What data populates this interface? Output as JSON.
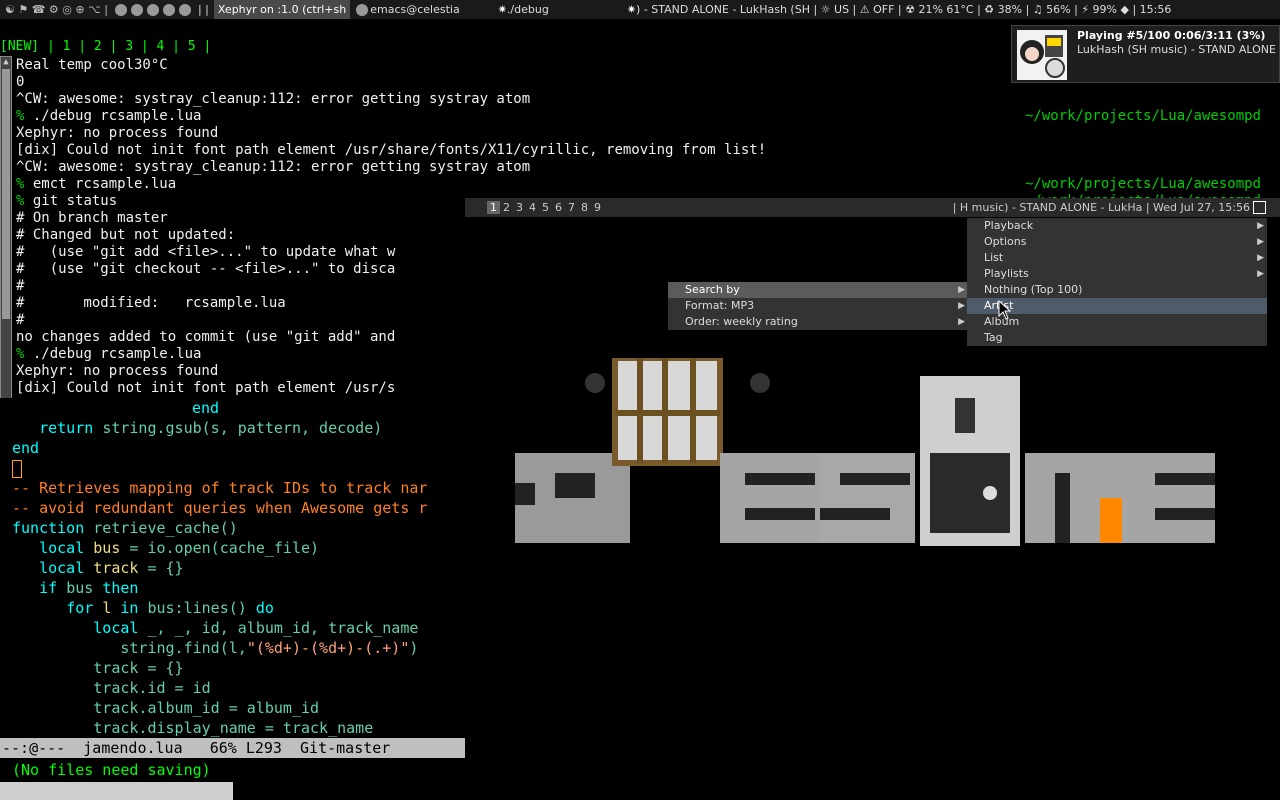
{
  "topbar": {
    "task1": "Xephyr on :1.0 (ctrl+sh",
    "task2": "emacs@celestia",
    "task3": "./debug",
    "status": ") - STAND ALONE - LukHash (SH   | ☼ US | ⚠ OFF | ☢ 21% 61°C | ♻ 38% | ♫ 56% | ⚡ 99% ◆ | 15:56"
  },
  "terminal": {
    "tags": "[NEW] | 1 | 2 | 3 | 4 | 5 |",
    "lines": [
      "Real temp cool30°C",
      "0",
      "^CW: awesome: systray_cleanup:112: error getting systray atom",
      "./debug rcsample.lua",
      "Xephyr: no process found",
      "[dix] Could not init font path element /usr/share/fonts/X11/cyrillic, removing from list!",
      "^CW: awesome: systray_cleanup:112: error getting systray atom",
      "emct rcsample.lua",
      "git status",
      "# On branch master",
      "# Changed but not updated:",
      "#   (use \"git add <file>...\" to update what w",
      "#   (use \"git checkout -- <file>...\" to disca",
      "#",
      "#       modified:   rcsample.lua",
      "#",
      "no changes added to commit (use \"git add\" and",
      "./debug rcsample.lua",
      "Xephyr: no process found",
      "[dix] Could not init font path element /usr/s"
    ],
    "prompt_char": "%",
    "path": "~/work/projects/Lua/awesompd"
  },
  "emacs": {
    "line1": "end",
    "line2_kw": "return",
    "line2_rest": "string.gsub(s, pattern, decode)",
    "line3": "end",
    "cmt1": "-- Retrieves mapping of track IDs to track nar",
    "cmt2": "-- avoid redundant queries when Awesome gets r",
    "func_kw": "function",
    "func_name": "retrieve_cache()",
    "local_kw": "local",
    "bus": "bus",
    "bus_rest": "= io.open(cache_file)",
    "track": "track",
    "track_rest": "= {}",
    "if_kw": "if",
    "if_var": "bus",
    "then_kw": "then",
    "for_kw": "for",
    "for_l": "l",
    "in_kw": "in",
    "for_rest": "bus:lines()",
    "do_kw": "do",
    "local2_rest": "_, _, id, album_id, track_name",
    "find_pre": "string.find(l,",
    "find_str": "\"(%d+)-(%d+)-(.+)\"",
    "find_post": ")",
    "l_track_reset": "track = {}",
    "l_track_id": "track.id = id",
    "l_track_album": "track.album_id = album_id",
    "l_track_name": "track.display_name = track_name",
    "modeline": "--:@---  jamendo.lua   66% L293  Git-master",
    "minibuffer": "(No files need saving)"
  },
  "xephyr": {
    "tags": [
      "1",
      "2",
      "3",
      "4",
      "5",
      "6",
      "7",
      "8",
      "9"
    ],
    "status": "| H music) - STAND ALONE - LukHa | Wed Jul 27, 15:56"
  },
  "menu_main": [
    "Playback",
    "Options",
    "List",
    "Playlists"
  ],
  "menu_search": [
    "Nothing (Top 100)",
    "Artist",
    "Album",
    "Tag"
  ],
  "menu_left": [
    "Search by",
    "Format: MP3",
    "Order: weekly rating"
  ],
  "nowplaying": {
    "title": "Playing #5/100 0:06/3:11 (3%)",
    "subtitle": "LukHash (SH music) - STAND ALONE"
  }
}
